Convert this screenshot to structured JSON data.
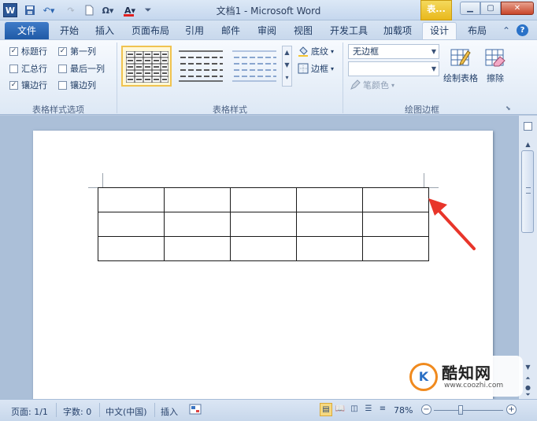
{
  "window": {
    "title": "文档1 - Microsoft Word",
    "context_tab_group": "表...",
    "app_logo": "W"
  },
  "quick_access": {
    "icons": [
      "word-logo-icon",
      "save-icon",
      "undo-icon",
      "redo-icon",
      "new-document-icon",
      "symbol-omega-icon",
      "font-color-icon",
      "customize-toolbar-icon"
    ]
  },
  "tabs": [
    {
      "label": "文件"
    },
    {
      "label": "开始"
    },
    {
      "label": "插入"
    },
    {
      "label": "页面布局"
    },
    {
      "label": "引用"
    },
    {
      "label": "邮件"
    },
    {
      "label": "审阅"
    },
    {
      "label": "视图"
    },
    {
      "label": "开发工具"
    },
    {
      "label": "加载项"
    },
    {
      "label": "设计",
      "active": true
    },
    {
      "label": "布局"
    }
  ],
  "ribbon": {
    "style_options": {
      "label": "表格样式选项",
      "checkboxes": [
        {
          "label": "标题行",
          "checked": true
        },
        {
          "label": "第一列",
          "checked": true
        },
        {
          "label": "汇总行",
          "checked": false
        },
        {
          "label": "最后一列",
          "checked": false
        },
        {
          "label": "镶边行",
          "checked": true
        },
        {
          "label": "镶边列",
          "checked": false
        }
      ]
    },
    "table_styles": {
      "label": "表格样式",
      "shading_label": "底纹",
      "borders_label": "边框"
    },
    "draw_borders": {
      "label": "绘图边框",
      "line_style_value": "无边框",
      "line_weight_value": "",
      "pen_color_label": "笔颜色",
      "draw_table_label": "绘制表格",
      "eraser_label": "擦除"
    }
  },
  "document": {
    "table": {
      "rows": 3,
      "columns": 5
    }
  },
  "watermark": {
    "name": "酷知网",
    "url": "www.coozhi.com",
    "logo_text": "K"
  },
  "status": {
    "page": "页面: 1/1",
    "words": "字数: 0",
    "language": "中文(中国)",
    "mode": "插入",
    "zoom": "78%",
    "zoom_fraction": 0.39
  },
  "colors": {
    "accent": "#2b5797",
    "arrow": "#e8352a",
    "context_tab": "#e9b81c"
  }
}
